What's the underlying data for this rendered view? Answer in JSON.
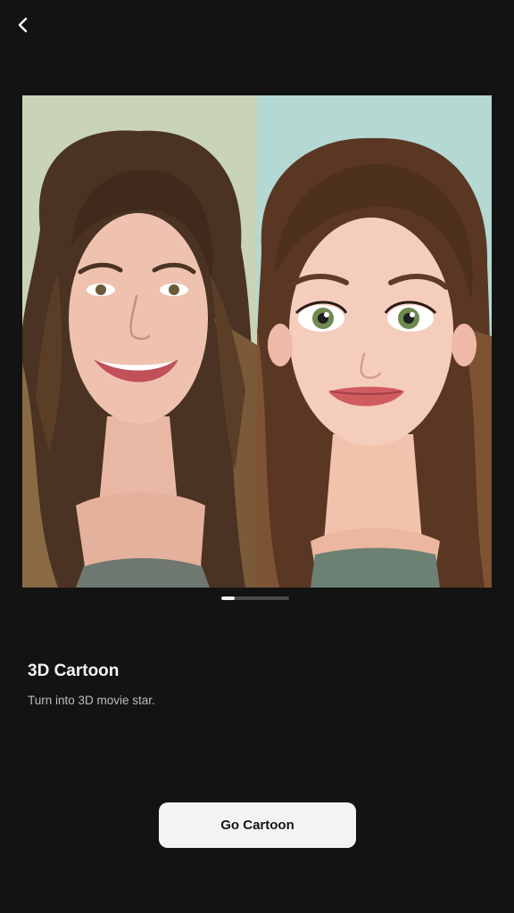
{
  "nav": {
    "back_icon": "chevron-left-icon"
  },
  "preview": {
    "panels": [
      {
        "name": "original-photo",
        "background": "#c9d3b6"
      },
      {
        "name": "cartoon-result",
        "background": "#b4d8d2"
      }
    ]
  },
  "pager": {
    "current": 1,
    "total": 5,
    "active_color": "#f2f2f2",
    "inactive_color": "#4a4a4a"
  },
  "feature": {
    "title": "3D Cartoon",
    "description": "Turn into 3D movie star."
  },
  "cta": {
    "label": "Go Cartoon"
  },
  "colors": {
    "background": "#131313",
    "button_bg": "#f3f3f3",
    "button_text": "#161616"
  }
}
